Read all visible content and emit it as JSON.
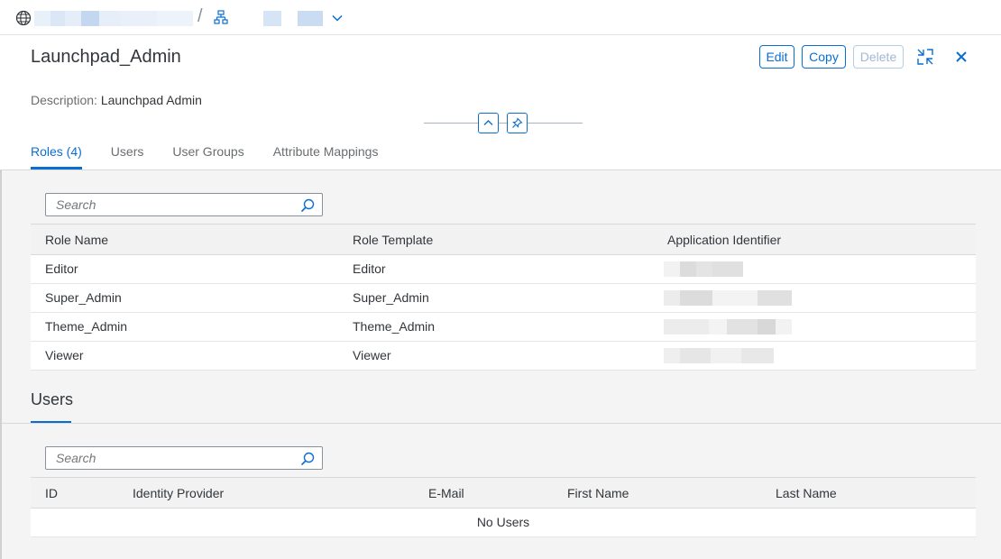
{
  "breadcrumb": {
    "separator": "/"
  },
  "header": {
    "title": "Launchpad_Admin",
    "description_label": "Description:",
    "description_value": "Launchpad Admin",
    "actions": {
      "edit": "Edit",
      "copy": "Copy",
      "delete": "Delete"
    },
    "icons": {
      "globe": "globe-icon",
      "org": "hierarchy-icon",
      "exit_fullscreen": "exit-full-screen-icon",
      "close": "close-icon",
      "collapse": "collapse-up-icon",
      "pin": "pin-icon"
    }
  },
  "tabs": [
    {
      "label": "Roles (4)",
      "active": true
    },
    {
      "label": "Users",
      "active": false
    },
    {
      "label": "User Groups",
      "active": false
    },
    {
      "label": "Attribute Mappings",
      "active": false
    }
  ],
  "roles": {
    "search_placeholder": "Search",
    "columns": [
      "Role Name",
      "Role Template",
      "Application Identifier"
    ],
    "rows": [
      {
        "role_name": "Editor",
        "role_template": "Editor"
      },
      {
        "role_name": "Super_Admin",
        "role_template": "Super_Admin"
      },
      {
        "role_name": "Theme_Admin",
        "role_template": "Theme_Admin"
      },
      {
        "role_name": "Viewer",
        "role_template": "Viewer"
      }
    ]
  },
  "users": {
    "section_title": "Users",
    "search_placeholder": "Search",
    "columns": [
      "ID",
      "Identity Provider",
      "E-Mail",
      "First Name",
      "Last Name"
    ],
    "no_data": "No Users"
  },
  "colors": {
    "accent": "#0a6ed1",
    "disabled": "#9fb8d2",
    "background": "#f4f4f4"
  }
}
